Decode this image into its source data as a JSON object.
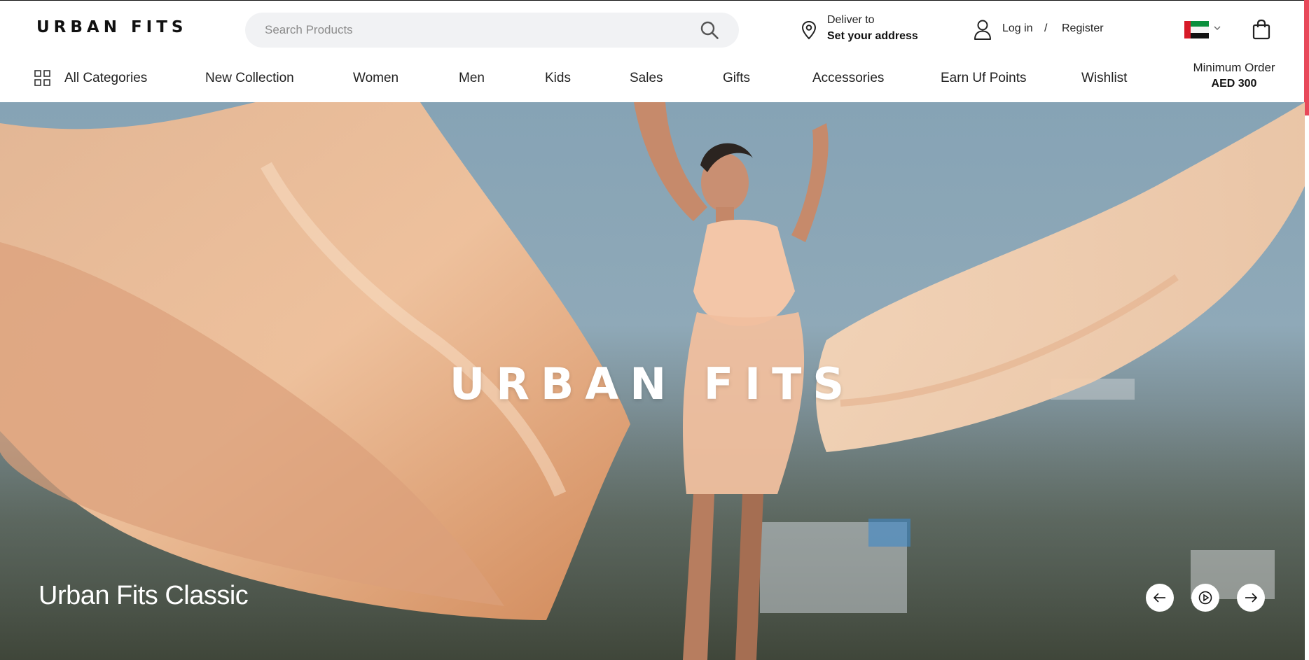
{
  "header": {
    "logo": "URBAN FITS",
    "search": {
      "placeholder": "Search Products",
      "icon": "search-icon"
    },
    "deliver": {
      "line1": "Deliver to",
      "line2": "Set your address",
      "icon": "location-pin-icon"
    },
    "account": {
      "login": "Log in",
      "separator": "/",
      "register": "Register",
      "icon": "user-icon"
    },
    "country": {
      "flag": "uae-flag-icon",
      "chevron": "chevron-down-icon"
    },
    "cart": {
      "icon": "shopping-bag-icon"
    }
  },
  "nav": {
    "categories_icon": "grid-icon",
    "items": [
      "All Categories",
      "New Collection",
      "Women",
      "Men",
      "Kids",
      "Sales",
      "Gifts",
      "Accessories",
      "Earn Uf Points",
      "Wishlist"
    ],
    "min_order_label": "Minimum Order",
    "min_order_value": "AED 300"
  },
  "hero": {
    "brand": "URBAN FITS",
    "caption": "Urban Fits Classic",
    "controls": [
      "prev-arrow-icon",
      "play-icon",
      "next-arrow-icon"
    ]
  },
  "colors": {
    "accent": "#e8495a",
    "text": "#1a1a1a",
    "search_bg": "#f1f2f4",
    "fabric": "#f0b98d"
  }
}
